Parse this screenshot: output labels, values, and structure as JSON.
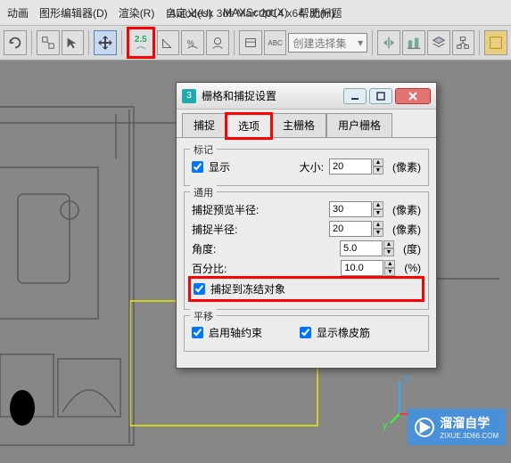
{
  "app": {
    "title": "Autodesk 3ds Max  2014 x64",
    "doc": "无标题"
  },
  "menu": {
    "anim": "动画",
    "graph": "图形编辑器(D)",
    "render": "渲染(R)",
    "custom": "自定义(U)",
    "maxscript": "MAXScript(X)",
    "help": "帮助(H)"
  },
  "toolbar": {
    "snap25": "2.5",
    "create_set": "创建选择集"
  },
  "dialog": {
    "title": "栅格和捕捉设置",
    "tabs": {
      "snap": "捕捉",
      "options": "选项",
      "home": "主栅格",
      "user": "用户栅格"
    },
    "marker": {
      "legend": "标记",
      "display": "显示",
      "size_label": "大小:",
      "size_value": "20",
      "size_unit": "(像素)"
    },
    "general": {
      "legend": "通用",
      "preview_radius_label": "捕捉预览半径:",
      "preview_radius_value": "30",
      "preview_radius_unit": "(像素)",
      "snap_radius_label": "捕捉半径:",
      "snap_radius_value": "20",
      "snap_radius_unit": "(像素)",
      "angle_label": "角度:",
      "angle_value": "5.0",
      "angle_unit": "(度)",
      "percent_label": "百分比:",
      "percent_value": "10.0",
      "percent_unit": "(%)",
      "snap_frozen": "捕捉到冻结对象"
    },
    "translate": {
      "legend": "平移",
      "axis_constraint": "启用轴约束",
      "rubber_band": "显示橡皮筋"
    }
  },
  "gizmo": {
    "x": "x",
    "y": "y",
    "z": "z"
  },
  "watermark": {
    "brand": "溜溜自学",
    "url": "ZIXUE.3D66.COM"
  }
}
